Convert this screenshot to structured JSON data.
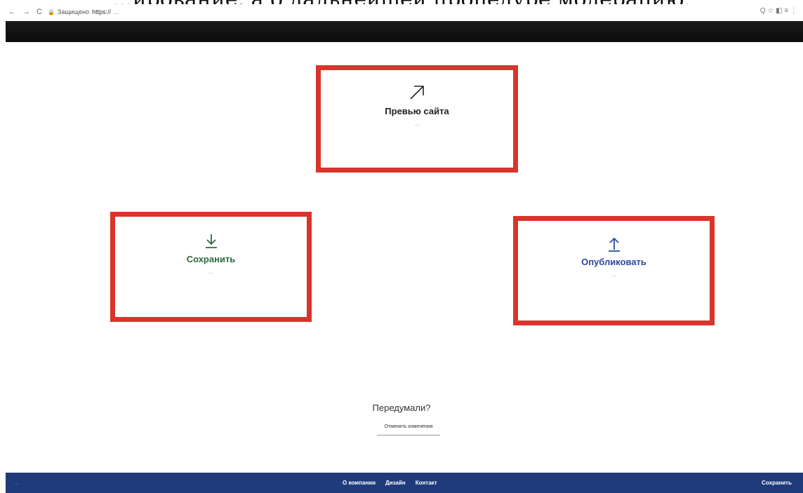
{
  "caption": "...ирование, а о дальнейшей процедуре модерацию.",
  "browser": {
    "nav_back": "←",
    "nav_forward": "→",
    "nav_reload": "C",
    "nav_home": "⌂",
    "lock_label": "Защищено",
    "host": "https://",
    "path": "...",
    "tools": "Q ☆ ◧ ≡ ⋮"
  },
  "cards": {
    "preview": {
      "title": "Превью сайта",
      "desc": "...",
      "icon": "arrow-up-right-icon",
      "color": "#222222"
    },
    "save": {
      "title": "Сохранить",
      "desc": "...",
      "icon": "download-arrow-icon",
      "color": "#2f6a3f"
    },
    "publish": {
      "title": "Опубликовать",
      "desc": "...",
      "icon": "upload-arrow-icon",
      "color": "#2a4a9a"
    }
  },
  "rethink": {
    "question": "Передумали?",
    "cancel_label": "Отменить изменения"
  },
  "footer": {
    "left": "...",
    "links": [
      "О компании",
      "Дизайн",
      "Контакт"
    ],
    "right": "Сохранить"
  },
  "colors": {
    "frame": "#d9342b",
    "footer_bg": "#1f3b7a",
    "header_bg": "#111111"
  }
}
